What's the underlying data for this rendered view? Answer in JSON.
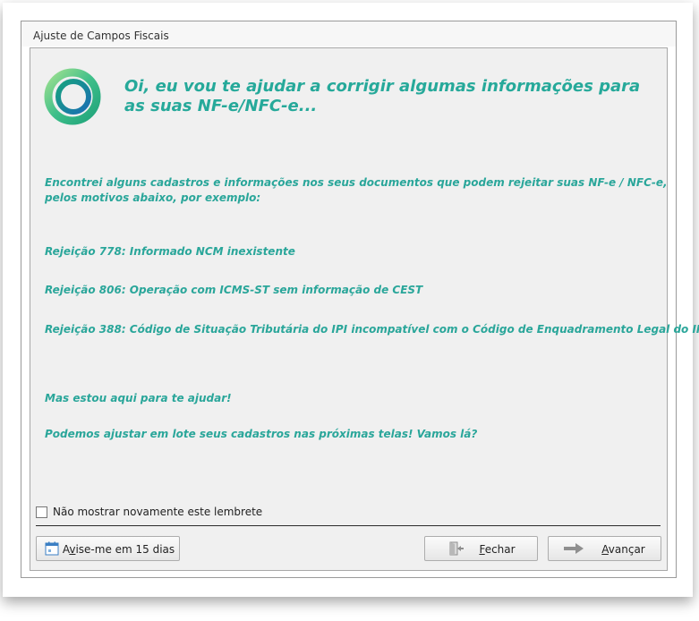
{
  "window": {
    "title": "Ajuste de Campos Fiscais"
  },
  "headline": "Oi, eu vou te ajudar a corrigir algumas informações para as suas NF-e/NFC-e...",
  "intro": {
    "line1": "Encontrei alguns cadastros e informações nos seus documentos que podem rejeitar suas NF-e / NFC-e,",
    "line2": "pelos motivos abaixo, por exemplo:"
  },
  "rejections": [
    "Rejeição 778: Informado NCM inexistente",
    "Rejeição 806: Operação com ICMS-ST sem informação de CEST",
    "Rejeição 388: Código de Situação Tributária do IPI incompatível com o Código de Enquadramento Legal do IPI"
  ],
  "closing": {
    "line1": "Mas estou aqui para te ajudar!",
    "line2": "Podemos ajustar em lote seus cadastros nas próximas telas! Vamos lá?"
  },
  "checkbox": {
    "label": "Não mostrar novamente este lembrete",
    "checked": false
  },
  "buttons": {
    "remind": {
      "pre": "A",
      "accel": "v",
      "post": "ise-me em 15 dias"
    },
    "close": {
      "pre": "",
      "accel": "F",
      "post": "echar"
    },
    "next": {
      "pre": "",
      "accel": "A",
      "post": "vançar"
    }
  },
  "colors": {
    "accent": "#26a99a",
    "logo_outer": "#7fd37a",
    "logo_inner": "#1e7fb7"
  },
  "icons": {
    "logo": "ring-logo-icon",
    "remind": "calendar-icon",
    "close": "exit-door-icon",
    "next": "arrow-right-icon"
  }
}
